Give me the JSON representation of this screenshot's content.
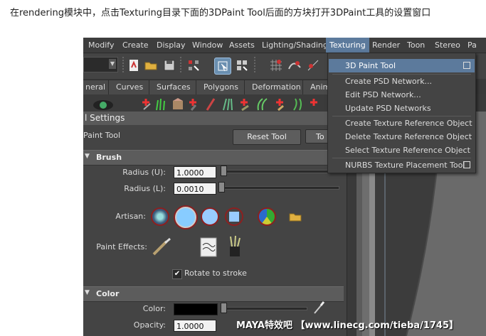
{
  "caption": "在rendering模块中，点击Texturing目录下面的3DPaint Tool后面的方块打开3DPaint工具的设置窗口",
  "menubar": {
    "items": [
      "Modify",
      "Create",
      "Display",
      "Window",
      "Assets",
      "Lighting/Shading",
      "Texturing",
      "Render",
      "Toon",
      "Stereo",
      "Pa"
    ],
    "active": "Texturing"
  },
  "shelf": {
    "tabs": [
      "neral",
      "Curves",
      "Surfaces",
      "Polygons",
      "Deformation",
      "Anim"
    ]
  },
  "tool_settings": {
    "title": "l Settings",
    "tool_name": "Paint Tool",
    "reset_button": "Reset Tool",
    "tool_help_button": "To"
  },
  "brush": {
    "header": "Brush",
    "radius_u_label": "Radius (U):",
    "radius_u_value": "1.0000",
    "radius_l_label": "Radius (L):",
    "radius_l_value": "0.0010",
    "artisan_label": "Artisan:",
    "paint_effects_label": "Paint Effects:",
    "rotate_to_stroke_label": "Rotate to stroke",
    "rotate_to_stroke_checked": true
  },
  "color": {
    "header": "Color",
    "color_label": "Color:",
    "color_value": "#000000",
    "opacity_label": "Opacity:",
    "opacity_value": "1.0000"
  },
  "texturing_menu": {
    "items": [
      "3D Paint Tool",
      "Create PSD Network...",
      "Edit PSD Network...",
      "Update PSD Networks",
      "Create Texture Reference Object",
      "Delete Texture Reference Object",
      "Select Texture Reference Object",
      "NURBS Texture Placement Tool"
    ],
    "highlighted": "3D Paint Tool"
  },
  "watermark": "MAYA特效吧 【www.linecg.com/tieba/1745】",
  "colors": {
    "highlight": "#5c7a9c",
    "ui_bg": "#444444",
    "menubar_bg": "#3d3d3d"
  }
}
